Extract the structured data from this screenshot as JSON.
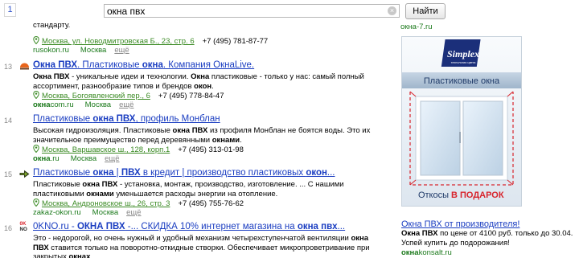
{
  "search": {
    "page_number": "1",
    "query": "окна пвх",
    "clear_symbol": "×",
    "button_label": "Найти"
  },
  "results": [
    {
      "number": "",
      "title": "",
      "snippet_html": "специальная технология монтажа. Она полностью соответствует данному государственному стандарту.",
      "address": "Москва, ул. Новодмитровская Б., 23, стр. 6",
      "phone": "+7 (495) 781-87-77",
      "domain_html": "rusokon.ru",
      "region": "Москва",
      "more": "ещё"
    },
    {
      "number": "13",
      "title_html": "<b>Окна ПВХ</b>. Пластиковые <b>окна</b>. Компания ОкнаLive.",
      "snippet_html": "<b>Окна ПВХ</b> - уникальные идеи и технологии. <b>Окна</b> пластиковые - только у нас: самый полный ассортимент, разнообразие типов и брендов <b>окон</b>.",
      "address": "Москва, Богоявленский пер., 6",
      "phone": "+7 (495) 778-84-47",
      "domain_html": "<b>окна</b>com.ru",
      "region": "Москва",
      "more": "ещё"
    },
    {
      "number": "14",
      "title_html": "Пластиковые <b>окна ПВХ</b>, профиль Монблан",
      "snippet_html": "Высокая гидроизоляция. Пластиковые <b>окна ПВХ</b> из профиля Монблан не боятся воды. Это их значительное преимущество перед деревянными <b>окнами</b>.",
      "address": "Москва, Варшавское ш., 128, корп.1",
      "phone": "+7 (495) 313-01-98",
      "domain_html": "<b>окна</b>.ru",
      "region": "Москва",
      "more": "ещё"
    },
    {
      "number": "15",
      "title_html": "Пластиковые <b>окна</b> | <b>ПВХ</b> в кредит | производство пластиковых <b>окон</b>...",
      "snippet_html": "Пластиковые <b>окна ПВХ</b> - установка, монтаж, производство, изготовление. ... С нашими пластиковыми <b>окнами</b> уменьшается расходы энергии на отопление.",
      "address": "Москва, Андроновское ш., 26, стр. 3",
      "phone": "+7 (495) 755-76-62",
      "domain_html": "zakaz-okon.ru",
      "region": "Москва",
      "more": "ещё"
    },
    {
      "number": "16",
      "title_html": "0KNO.ru - <b>ОКНА ПВХ</b> -... СКИДКА 10% интернет магазина на <b>окна пвх</b>...",
      "snippet_html": "Это - недорогой, но очень нужный и удобный механизм четырехступенчатой вентиляции <b>окна ПВХ</b> ставится только на поворотно-откидные створки. Обеспечивает микропроветривание при закрытых <b>окнах</b>.",
      "address": "",
      "phone": "",
      "domain_html": "",
      "region": "",
      "more": ""
    }
  ],
  "ad": {
    "top_domain": "окна-7.ru",
    "banner": {
      "brand": "Simplex",
      "brand_tagline": "технология цвета",
      "headline": "Пластиковые окна",
      "footer_text": "Откосы",
      "footer_highlight": "В ПОДАРОК",
      "accent_color": "#d8242c",
      "brand_color": "#1b2f7a"
    },
    "title": "Окна ПВХ от производителя!",
    "text_html": "<b>Окна ПВХ</b> по цене от 4100 руб. только до 30.04. Успей купить до подорожания!",
    "domain_html": "<b>окна</b>konsalt.ru"
  }
}
